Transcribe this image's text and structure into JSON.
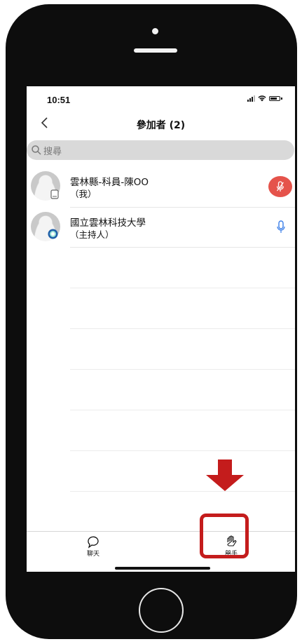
{
  "status_bar": {
    "time": "10:51"
  },
  "nav": {
    "back_icon": "chevron-left-icon",
    "title": "參加者 (2)"
  },
  "search": {
    "icon": "search-icon",
    "placeholder": "搜尋"
  },
  "participants": [
    {
      "name": "雲林縣-科員-陳OO",
      "role": "（我）",
      "badge_icon": "phone-device-icon",
      "mic_icon": "microphone-icon",
      "mic_color": "#e5534b"
    },
    {
      "name": "國立雲林科技大學",
      "role": "（主持人）",
      "badge_icon": "host-icon",
      "mic_icon": "microphone-icon",
      "mic_color": "#3a7ee8"
    }
  ],
  "tabbar": {
    "chat": {
      "label": "聊天",
      "icon": "chat-bubble-icon"
    },
    "raise_hand": {
      "label": "舉手",
      "icon": "raise-hand-icon"
    }
  },
  "annotation": {
    "arrow_color": "#c41c1c",
    "highlight_color": "#c41c1c"
  }
}
